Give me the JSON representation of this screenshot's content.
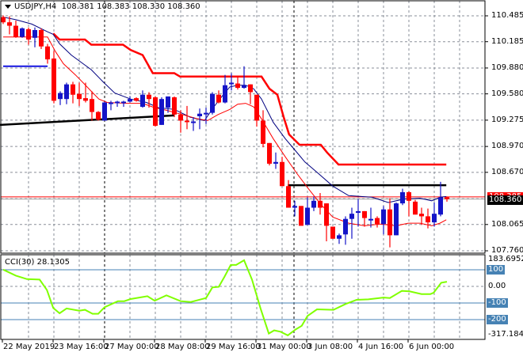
{
  "header": {
    "symbol": "USDJPY,H4",
    "open": "108.381",
    "high": "108.383",
    "low": "108.330",
    "close": "108.360"
  },
  "price_axis": {
    "labels": [
      "110.485",
      "110.185",
      "109.880",
      "109.580",
      "109.275",
      "108.970",
      "108.670",
      "108.065",
      "107.760"
    ],
    "label_values": [
      110.485,
      110.185,
      109.88,
      109.58,
      109.275,
      108.97,
      108.67,
      108.065,
      107.76
    ],
    "grid_values": [
      110.485,
      110.185,
      109.88,
      109.58,
      109.275,
      108.97,
      108.67,
      108.365,
      108.065,
      107.76
    ],
    "bid_label": "108.360",
    "ask_label": "108.385",
    "bid": 108.36,
    "ask": 108.385,
    "range": [
      107.76,
      110.485
    ]
  },
  "cci": {
    "title": "CCI(30) 28.1305",
    "axis_max": "183.6952",
    "axis_min": "-317.184",
    "levels": [
      {
        "v": 100,
        "label": "100"
      },
      {
        "v": -100,
        "label": "-100"
      },
      {
        "v": -200,
        "label": "-200"
      }
    ],
    "zero_label": "0.00",
    "range": [
      -317.184,
      183.6952
    ],
    "points": [
      [
        0,
        101
      ],
      [
        2,
        65
      ],
      [
        3.75,
        44
      ],
      [
        5.75,
        41
      ],
      [
        6.9,
        -22
      ],
      [
        7.9,
        -130
      ],
      [
        8.9,
        -162
      ],
      [
        10,
        -133
      ],
      [
        12,
        -146
      ],
      [
        12.9,
        -141
      ],
      [
        14.1,
        -165
      ],
      [
        15,
        -165
      ],
      [
        16,
        -125
      ],
      [
        18.1,
        -89
      ],
      [
        19.1,
        -89
      ],
      [
        20.1,
        -76
      ],
      [
        22.75,
        -59
      ],
      [
        23.9,
        -86
      ],
      [
        25.75,
        -54
      ],
      [
        28,
        -89
      ],
      [
        29.6,
        -94
      ],
      [
        32,
        -70
      ],
      [
        33,
        -6
      ],
      [
        34,
        -3
      ],
      [
        34.9,
        57
      ],
      [
        35.9,
        129
      ],
      [
        36.75,
        129
      ],
      [
        38,
        157
      ],
      [
        39.25,
        41
      ],
      [
        40.6,
        -133
      ],
      [
        41.9,
        -284
      ],
      [
        42.75,
        -265
      ],
      [
        43.75,
        -273
      ],
      [
        44.9,
        -295
      ],
      [
        46.1,
        -260
      ],
      [
        47.1,
        -237
      ],
      [
        48,
        -178
      ],
      [
        49.5,
        -138
      ],
      [
        52.1,
        -141
      ],
      [
        54,
        -106
      ],
      [
        55.75,
        -81
      ],
      [
        57.6,
        -78
      ],
      [
        60,
        -67
      ],
      [
        61,
        -70
      ],
      [
        62.9,
        -27
      ],
      [
        64.1,
        -30
      ],
      [
        66,
        -46
      ],
      [
        67.4,
        -46
      ],
      [
        67.9,
        -38
      ],
      [
        69.1,
        22
      ],
      [
        70,
        28.13
      ]
    ]
  },
  "time_axis": {
    "labels": [
      {
        "i": 0,
        "text": "22 May 2019"
      },
      {
        "i": 8,
        "text": "23 May 16:00"
      },
      {
        "i": 16,
        "text": "27 May 00:00"
      },
      {
        "i": 24,
        "text": "28 May 08:00"
      },
      {
        "i": 32,
        "text": "29 May 16:00"
      },
      {
        "i": 40,
        "text": "31 May 00:00"
      },
      {
        "i": 48,
        "text": "3 Jun 08:00"
      },
      {
        "i": 56,
        "text": "4 Jun 16:00"
      },
      {
        "i": 64,
        "text": "6 Jun 00:00"
      }
    ],
    "period_separators": [
      16,
      45843
    ]
  },
  "colors": {
    "bull": "#1414c8",
    "bear": "#ff0000",
    "ma_slow": "#000080",
    "ma_fast": "#ff0000",
    "stop": "#ff0000",
    "cci": "#80ff00",
    "level": "#4682b4",
    "grid": "#8a8f99"
  },
  "chart_data": {
    "type": "candlestick",
    "candles_ohlc": [
      [
        110.47,
        110.49,
        110.39,
        110.41
      ],
      [
        110.41,
        110.48,
        110.27,
        110.37
      ],
      [
        110.37,
        110.43,
        110.23,
        110.24
      ],
      [
        110.24,
        110.35,
        110.23,
        110.34
      ],
      [
        110.33,
        110.35,
        110.15,
        110.21
      ],
      [
        110.23,
        110.35,
        110.12,
        110.32
      ],
      [
        110.32,
        110.34,
        110.1,
        110.13
      ],
      [
        110.13,
        110.16,
        109.93,
        109.98
      ],
      [
        109.99,
        110.08,
        109.47,
        109.5
      ],
      [
        109.52,
        109.61,
        109.45,
        109.59
      ],
      [
        109.52,
        109.71,
        109.46,
        109.69
      ],
      [
        109.69,
        109.72,
        109.47,
        109.57
      ],
      [
        109.58,
        109.71,
        109.44,
        109.52
      ],
      [
        109.53,
        109.71,
        109.48,
        109.5
      ],
      [
        109.52,
        109.61,
        109.27,
        109.37
      ],
      [
        109.37,
        109.38,
        109.27,
        109.28
      ],
      [
        109.27,
        109.49,
        109.27,
        109.48
      ],
      [
        109.47,
        109.5,
        109.39,
        109.48
      ],
      [
        109.48,
        109.5,
        109.43,
        109.49
      ],
      [
        109.48,
        109.5,
        109.43,
        109.49
      ],
      [
        109.49,
        109.55,
        109.48,
        109.52
      ],
      [
        109.53,
        109.54,
        109.49,
        109.5
      ],
      [
        109.43,
        109.62,
        109.42,
        109.57
      ],
      [
        109.57,
        109.6,
        109.42,
        109.52
      ],
      [
        109.54,
        109.55,
        109.2,
        109.21
      ],
      [
        109.22,
        109.54,
        109.22,
        109.52
      ],
      [
        109.42,
        109.55,
        109.36,
        109.55
      ],
      [
        109.54,
        109.55,
        109.31,
        109.34
      ],
      [
        109.34,
        109.39,
        109.13,
        109.27
      ],
      [
        109.27,
        109.44,
        109.17,
        109.26
      ],
      [
        109.25,
        109.31,
        109.15,
        109.26
      ],
      [
        109.32,
        109.41,
        109.17,
        109.35
      ],
      [
        109.35,
        109.42,
        109.23,
        109.36
      ],
      [
        109.36,
        109.6,
        109.34,
        109.58
      ],
      [
        109.57,
        109.62,
        109.47,
        109.48
      ],
      [
        109.48,
        109.8,
        109.47,
        109.68
      ],
      [
        109.7,
        109.82,
        109.62,
        109.71
      ],
      [
        109.7,
        109.77,
        109.63,
        109.65
      ],
      [
        109.65,
        109.9,
        109.64,
        109.68
      ],
      [
        109.69,
        109.69,
        109.46,
        109.6
      ],
      [
        109.57,
        109.57,
        109.2,
        109.27
      ],
      [
        109.27,
        109.39,
        108.96,
        109.0
      ],
      [
        109.01,
        109.01,
        108.75,
        108.77
      ],
      [
        108.77,
        108.9,
        108.71,
        108.79
      ],
      [
        108.79,
        108.85,
        108.51,
        108.51
      ],
      [
        108.51,
        108.58,
        108.26,
        108.26
      ],
      [
        108.26,
        108.34,
        108.16,
        108.28
      ],
      [
        108.28,
        108.28,
        108.05,
        108.05
      ],
      [
        108.06,
        108.38,
        108.06,
        108.26
      ],
      [
        108.26,
        108.39,
        108.22,
        108.34
      ],
      [
        108.34,
        108.43,
        108.18,
        108.26
      ],
      [
        108.31,
        108.31,
        107.87,
        108.05
      ],
      [
        108.04,
        108.04,
        107.9,
        107.9
      ],
      [
        107.9,
        107.96,
        107.84,
        107.94
      ],
      [
        107.95,
        108.16,
        107.83,
        108.13
      ],
      [
        108.13,
        108.26,
        107.9,
        108.19
      ],
      [
        108.2,
        108.36,
        108.04,
        108.22
      ],
      [
        108.22,
        108.22,
        108.04,
        108.14
      ],
      [
        108.12,
        108.26,
        108.03,
        108.13
      ],
      [
        108.14,
        108.16,
        108.03,
        108.07
      ],
      [
        108.07,
        108.28,
        107.95,
        108.24
      ],
      [
        108.24,
        108.37,
        107.8,
        107.94
      ],
      [
        107.94,
        108.32,
        107.94,
        108.31
      ],
      [
        108.31,
        108.48,
        108.29,
        108.44
      ],
      [
        108.44,
        108.45,
        108.16,
        108.34
      ],
      [
        108.33,
        108.35,
        108.18,
        108.18
      ],
      [
        108.19,
        108.26,
        108.06,
        108.16
      ],
      [
        108.16,
        108.25,
        108.02,
        108.09
      ],
      [
        108.09,
        108.32,
        108.04,
        108.19
      ],
      [
        108.18,
        108.56,
        108.16,
        108.38
      ],
      [
        108.38,
        108.39,
        108.33,
        108.36
      ]
    ],
    "ma_slow": [
      [
        0,
        110.47
      ],
      [
        2,
        110.44
      ],
      [
        4.5,
        110.39
      ],
      [
        7,
        110.3
      ],
      [
        7.9,
        110.27
      ],
      [
        8.9,
        110.16
      ],
      [
        10.75,
        110.03
      ],
      [
        12.6,
        109.93
      ],
      [
        13.9,
        109.86
      ],
      [
        15.75,
        109.72
      ],
      [
        17.6,
        109.59
      ],
      [
        20.1,
        109.52
      ],
      [
        22.6,
        109.48
      ],
      [
        24.5,
        109.42
      ],
      [
        27,
        109.4
      ],
      [
        29.5,
        109.31
      ],
      [
        31.75,
        109.27
      ],
      [
        33.25,
        109.43
      ],
      [
        34.5,
        109.55
      ],
      [
        35.75,
        109.66
      ],
      [
        37,
        109.68
      ],
      [
        38.25,
        109.68
      ],
      [
        39.5,
        109.64
      ],
      [
        40.75,
        109.52
      ],
      [
        42.6,
        109.25
      ],
      [
        44.5,
        109.06
      ],
      [
        46,
        108.93
      ],
      [
        47.6,
        108.79
      ],
      [
        49.5,
        108.67
      ],
      [
        52,
        108.51
      ],
      [
        54.5,
        108.4
      ],
      [
        58.25,
        108.38
      ],
      [
        60.75,
        108.32
      ],
      [
        63.25,
        108.36
      ],
      [
        65.75,
        108.37
      ],
      [
        67.6,
        108.34
      ],
      [
        68.9,
        108.38
      ],
      [
        69.9,
        108.39
      ]
    ],
    "ma_fast": [
      [
        0,
        110.24
      ],
      [
        7,
        110.24
      ],
      [
        8.25,
        110.07
      ],
      [
        9.5,
        109.93
      ],
      [
        11.4,
        109.8
      ],
      [
        12.6,
        109.71
      ],
      [
        13.9,
        109.61
      ],
      [
        15.1,
        109.52
      ],
      [
        16.4,
        109.48
      ],
      [
        19.5,
        109.47
      ],
      [
        22,
        109.47
      ],
      [
        23.9,
        109.42
      ],
      [
        25.75,
        109.39
      ],
      [
        28.25,
        109.34
      ],
      [
        30.75,
        109.29
      ],
      [
        32.25,
        109.27
      ],
      [
        33.9,
        109.34
      ],
      [
        35.75,
        109.4
      ],
      [
        37,
        109.46
      ],
      [
        38.25,
        109.47
      ],
      [
        39.5,
        109.43
      ],
      [
        40.75,
        109.29
      ],
      [
        42.6,
        109.06
      ],
      [
        44.5,
        108.85
      ],
      [
        46.4,
        108.65
      ],
      [
        48.25,
        108.47
      ],
      [
        50.1,
        108.3
      ],
      [
        52,
        108.15
      ],
      [
        54.5,
        108.08
      ],
      [
        57,
        108.05
      ],
      [
        59.5,
        108.07
      ],
      [
        62,
        108.05
      ],
      [
        63.9,
        108.08
      ],
      [
        65.75,
        108.08
      ],
      [
        67.6,
        108.05
      ],
      [
        68.9,
        108.08
      ],
      [
        69.9,
        108.12
      ]
    ],
    "trailing_stop": [
      [
        7.9,
        110.28
      ],
      [
        8.9,
        110.21
      ],
      [
        12.9,
        110.21
      ],
      [
        13.9,
        110.15
      ],
      [
        18.9,
        110.15
      ],
      [
        20.1,
        110.09
      ],
      [
        22,
        110.03
      ],
      [
        23.6,
        109.82
      ],
      [
        27,
        109.82
      ],
      [
        27.9,
        109.78
      ],
      [
        40.75,
        109.78
      ],
      [
        42,
        109.64
      ],
      [
        43.25,
        109.57
      ],
      [
        44.25,
        109.31
      ],
      [
        45.1,
        109.11
      ],
      [
        46.75,
        108.99
      ],
      [
        50.1,
        108.99
      ],
      [
        51.1,
        108.9
      ],
      [
        52.9,
        108.76
      ],
      [
        69.9,
        108.76
      ]
    ],
    "blue_level": {
      "from": 0,
      "to": 7,
      "price": 109.9
    },
    "black_trendline": {
      "from": [
        0,
        109.22
      ],
      "to": [
        27,
        109.33
      ]
    },
    "black_level": {
      "from": 44.9,
      "to": 69.9,
      "price": 108.52
    }
  }
}
